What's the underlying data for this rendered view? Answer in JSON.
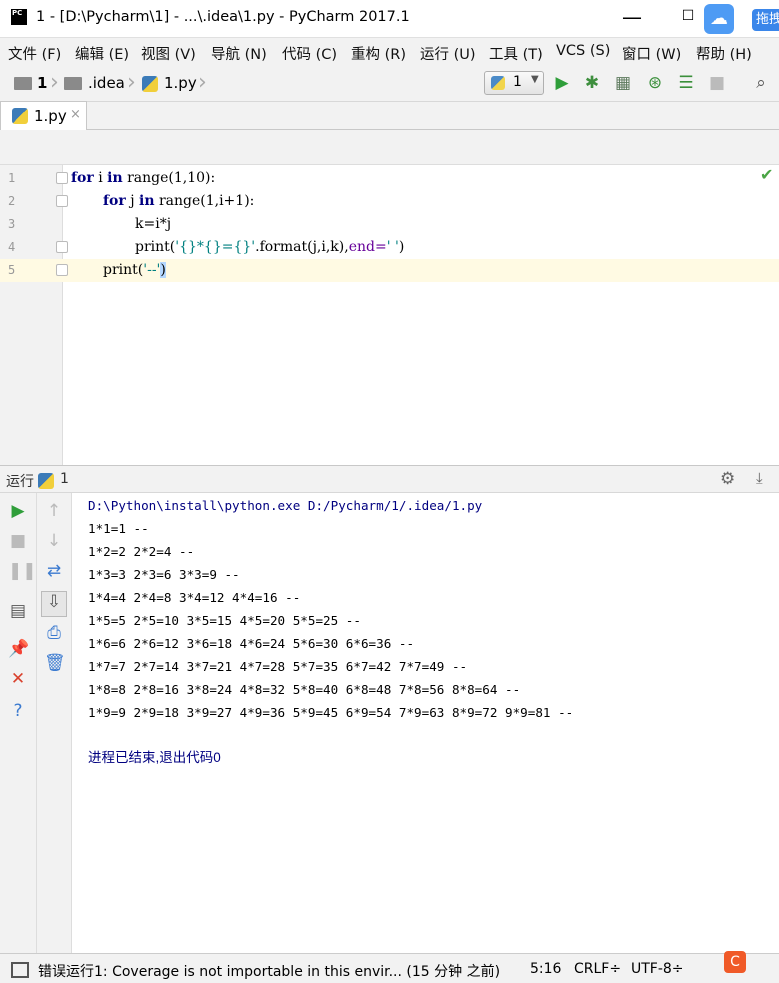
{
  "window": {
    "logo": "PC",
    "title": "1 - [D:\\Pycharm\\1] - ...\\.idea\\1.py - PyCharm 2017.1",
    "minimize": "—",
    "maximize": "☐",
    "baidu_label": "拖拽"
  },
  "menu": [
    {
      "label": "文件 (F)"
    },
    {
      "label": "编辑 (E)"
    },
    {
      "label": "视图 (V)"
    },
    {
      "label": "导航 (N)"
    },
    {
      "label": "代码 (C)"
    },
    {
      "label": "重构 (R)"
    },
    {
      "label": "运行 (U)"
    },
    {
      "label": "工具 (T)"
    },
    {
      "label": "VCS (S)"
    },
    {
      "label": "窗口 (W)"
    },
    {
      "label": "帮助 (H)"
    }
  ],
  "breadcrumb": [
    "1",
    ".idea",
    "1.py"
  ],
  "run_config": {
    "label": "1"
  },
  "toolbar_icons": [
    "run-icon",
    "debug-icon",
    "coverage-icon",
    "profile-icon",
    "concurrency-icon",
    "stop-icon",
    "search-icon"
  ],
  "tab": {
    "label": "1.py",
    "close": "×"
  },
  "editor": {
    "lines": [
      {
        "num": "1"
      },
      {
        "num": "2"
      },
      {
        "num": "3"
      },
      {
        "num": "4"
      },
      {
        "num": "5"
      }
    ],
    "tokens": {
      "l1_kw1": "for",
      "l1_a": " i ",
      "l1_kw2": "in",
      "l1_b": " range(1,10):",
      "l2_kw1": "for",
      "l2_a": " j ",
      "l2_kw2": "in",
      "l2_b": " range(1,i+1):",
      "l3": "k=i*j",
      "l4_a": "print(",
      "l4_str1": "'{}*{}={}'",
      "l4_b": ".format(j,i,k),",
      "l4_kw": "end=",
      "l4_str2": "' '",
      "l4_c": ")",
      "l5_a": "print(",
      "l5_str": "'--'",
      "l5_b": ")"
    },
    "inspection": "✔"
  },
  "run_panel": {
    "title": "运行",
    "config": "1",
    "console": [
      "D:\\Python\\install\\python.exe D:/Pycharm/1/.idea/1.py",
      "1*1=1 --",
      "1*2=2 2*2=4 --",
      "1*3=3 2*3=6 3*3=9 --",
      "1*4=4 2*4=8 3*4=12 4*4=16 --",
      "1*5=5 2*5=10 3*5=15 4*5=20 5*5=25 --",
      "1*6=6 2*6=12 3*6=18 4*6=24 5*6=30 6*6=36 --",
      "1*7=7 2*7=14 3*7=21 4*7=28 5*7=35 6*7=42 7*7=49 --",
      "1*8=8 2*8=16 3*8=24 4*8=32 5*8=40 6*8=48 7*8=56 8*8=64 --",
      "1*9=9 2*9=18 3*9=27 4*9=36 5*9=45 6*9=54 7*9=63 8*9=72 9*9=81 --"
    ],
    "exit_message": "进程已结束,退出代码0"
  },
  "status": {
    "message": "错误运行1: Coverage is not importable in this envir... (15 分钟 之前)",
    "position": "5:16",
    "line_sep": "CRLF÷",
    "encoding": "UTF-8÷"
  },
  "colors": {
    "keyword": "#000080",
    "string": "#008080",
    "run_green": "#3aa23a",
    "stop_red": "#d9412d"
  }
}
